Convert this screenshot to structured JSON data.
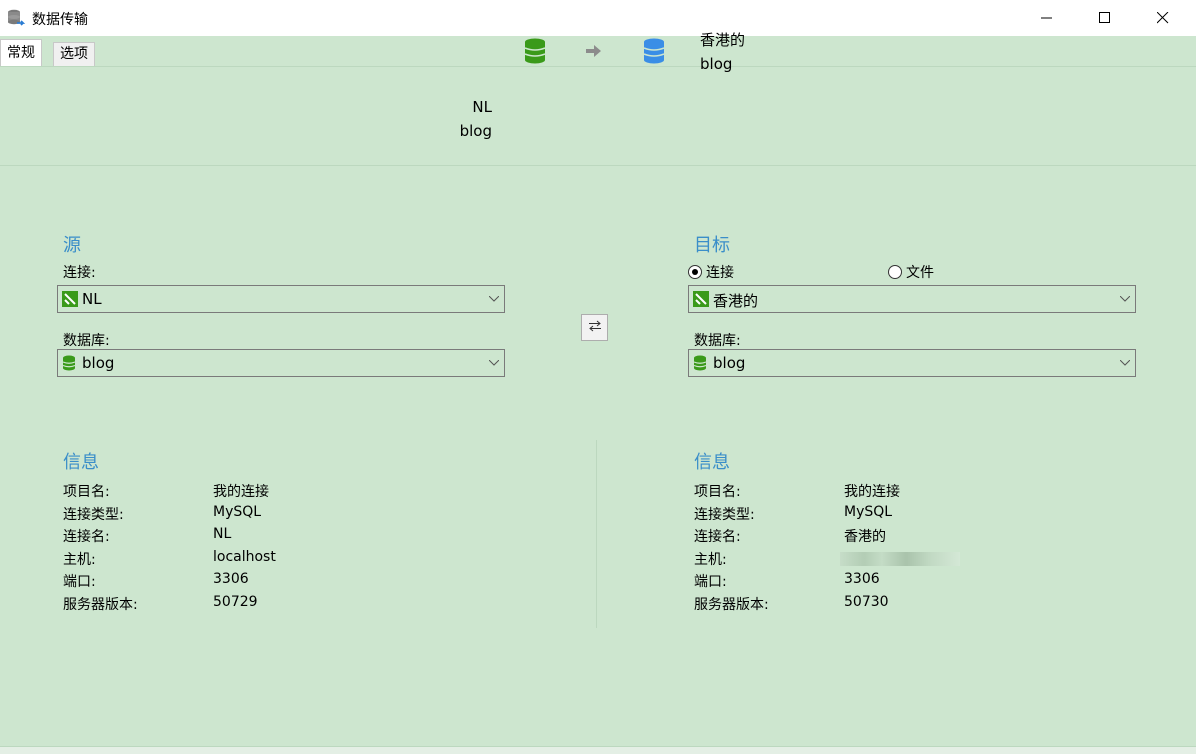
{
  "window": {
    "title": "数据传输",
    "icon": "database-transfer-icon"
  },
  "tabs": [
    {
      "label": "常规",
      "active": true
    },
    {
      "label": "选项",
      "active": false
    }
  ],
  "header": {
    "source_connection": "NL",
    "source_database": "blog",
    "target_connection": "香港的",
    "target_database": "blog",
    "source_color": "#3a9a1a",
    "target_color": "#3a8ee6"
  },
  "source": {
    "title": "源",
    "connection_label": "连接:",
    "connection_value": "NL",
    "database_label": "数据库:",
    "database_value": "blog"
  },
  "target": {
    "title": "目标",
    "radio_connection": "连接",
    "radio_file": "文件",
    "connection_value": "香港的",
    "database_label": "数据库:",
    "database_value": "blog"
  },
  "source_info": {
    "title": "信息",
    "rows": [
      {
        "key": "项目名:",
        "value": "我的连接"
      },
      {
        "key": "连接类型:",
        "value": "MySQL"
      },
      {
        "key": "连接名:",
        "value": "NL"
      },
      {
        "key": "主机:",
        "value": "localhost"
      },
      {
        "key": "端口:",
        "value": "3306"
      },
      {
        "key": "服务器版本:",
        "value": "50729"
      }
    ]
  },
  "target_info": {
    "title": "信息",
    "rows": [
      {
        "key": "项目名:",
        "value": "我的连接"
      },
      {
        "key": "连接类型:",
        "value": "MySQL"
      },
      {
        "key": "连接名:",
        "value": "香港的"
      },
      {
        "key": "主机:",
        "value": ""
      },
      {
        "key": "端口:",
        "value": "3306"
      },
      {
        "key": "服务器版本:",
        "value": "50730"
      }
    ]
  }
}
